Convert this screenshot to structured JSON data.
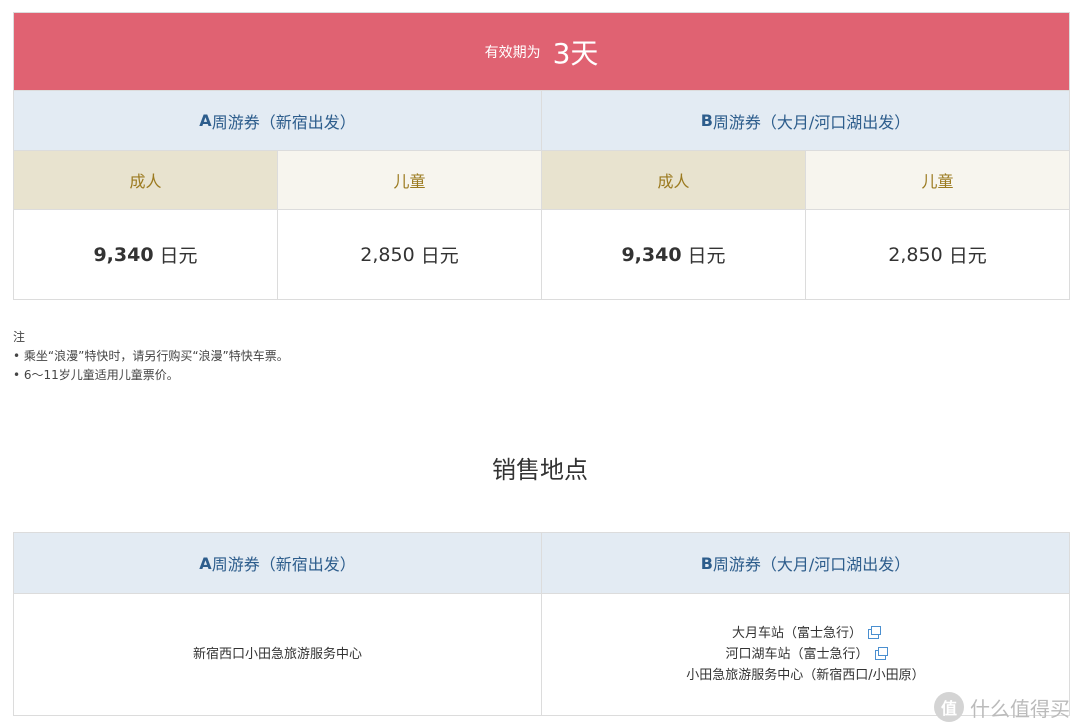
{
  "validity": {
    "label": "有效期为",
    "value": "3天"
  },
  "passes": [
    {
      "prefix": "A",
      "name": "周游券（新宿出发）"
    },
    {
      "prefix": "B",
      "name": "周游券（大月/河口湖出发）"
    }
  ],
  "categories": {
    "adult": "成人",
    "child": "儿童"
  },
  "prices": {
    "a_adult": "9,340",
    "a_child": "2,850",
    "b_adult": "9,340",
    "b_child": "2,850",
    "unit": "日元"
  },
  "notes": {
    "title": "注",
    "items": [
      "• 乘坐“浪漫”特快时，请另行购买“浪漫”特快车票。",
      "• 6～11岁儿童适用儿童票价。"
    ]
  },
  "sales": {
    "title": "销售地点",
    "a_locations": [
      "新宿西口小田急旅游服务中心"
    ],
    "b_locations": [
      "大月车站（富士急行）",
      "河口湖车站（富士急行）",
      "小田急旅游服务中心（新宿西口/小田原）"
    ]
  },
  "watermark": {
    "badge": "值",
    "text": "什么值得买"
  },
  "colors": {
    "header_red": "#e06272",
    "pass_blue": "#2d5d8c",
    "category_gold": "#9b7a1f",
    "link_icon_blue": "#4a8fd0"
  }
}
